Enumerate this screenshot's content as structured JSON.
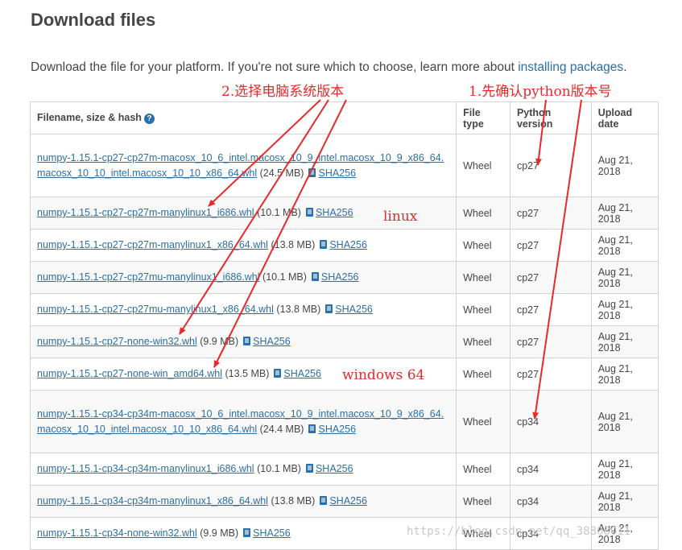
{
  "page": {
    "title": "Download files",
    "intro_text": "Download the file for your platform. If you're not sure which to choose, learn more about ",
    "intro_link": "installing packages",
    "intro_end": "."
  },
  "table": {
    "headers": {
      "filename": "Filename, size & hash",
      "file_type": "File type",
      "python_version": "Python version",
      "upload_date": "Upload date"
    },
    "hash_label": "SHA256",
    "rows": [
      {
        "name": "numpy-1.15.1-cp27-cp27m-macosx_10_6_intel.macosx_10_9_intel.macosx_10_9_x86_64.macosx_10_10_intel.macosx_10_10_x86_64.whl",
        "size": "(24.5 MB)",
        "type": "Wheel",
        "python": "cp27",
        "date": "Aug 21, 2018"
      },
      {
        "name": "numpy-1.15.1-cp27-cp27m-manylinux1_i686.whl",
        "size": "(10.1 MB)",
        "type": "Wheel",
        "python": "cp27",
        "date": "Aug 21, 2018"
      },
      {
        "name": "numpy-1.15.1-cp27-cp27m-manylinux1_x86_64.whl",
        "size": "(13.8 MB)",
        "type": "Wheel",
        "python": "cp27",
        "date": "Aug 21, 2018"
      },
      {
        "name": "numpy-1.15.1-cp27-cp27mu-manylinux1_i686.whl",
        "size": "(10.1 MB)",
        "type": "Wheel",
        "python": "cp27",
        "date": "Aug 21, 2018"
      },
      {
        "name": "numpy-1.15.1-cp27-cp27mu-manylinux1_x86_64.whl",
        "size": "(13.8 MB)",
        "type": "Wheel",
        "python": "cp27",
        "date": "Aug 21, 2018"
      },
      {
        "name": "numpy-1.15.1-cp27-none-win32.whl",
        "size": "(9.9 MB)",
        "type": "Wheel",
        "python": "cp27",
        "date": "Aug 21, 2018"
      },
      {
        "name": "numpy-1.15.1-cp27-none-win_amd64.whl",
        "size": "(13.5 MB)",
        "type": "Wheel",
        "python": "cp27",
        "date": "Aug 21, 2018"
      },
      {
        "name": "numpy-1.15.1-cp34-cp34m-macosx_10_6_intel.macosx_10_9_intel.macosx_10_9_x86_64.macosx_10_10_intel.macosx_10_10_x86_64.whl",
        "size": "(24.4 MB)",
        "type": "Wheel",
        "python": "cp34",
        "date": "Aug 21, 2018"
      },
      {
        "name": "numpy-1.15.1-cp34-cp34m-manylinux1_i686.whl",
        "size": "(10.1 MB)",
        "type": "Wheel",
        "python": "cp34",
        "date": "Aug 21, 2018"
      },
      {
        "name": "numpy-1.15.1-cp34-cp34m-manylinux1_x86_64.whl",
        "size": "(13.8 MB)",
        "type": "Wheel",
        "python": "cp34",
        "date": "Aug 21, 2018"
      },
      {
        "name": "numpy-1.15.1-cp34-none-win32.whl",
        "size": "(9.9 MB)",
        "type": "Wheel",
        "python": "cp34",
        "date": "Aug 21, 2018"
      }
    ]
  },
  "annotations": {
    "select_system": "2.选择电脑系统版本",
    "confirm_python": "1.先确认python版本号",
    "linux": "linux",
    "windows": "windows 64",
    "color": "#e8292b"
  },
  "watermark": "https://blog.csdn.net/qq_38808011"
}
